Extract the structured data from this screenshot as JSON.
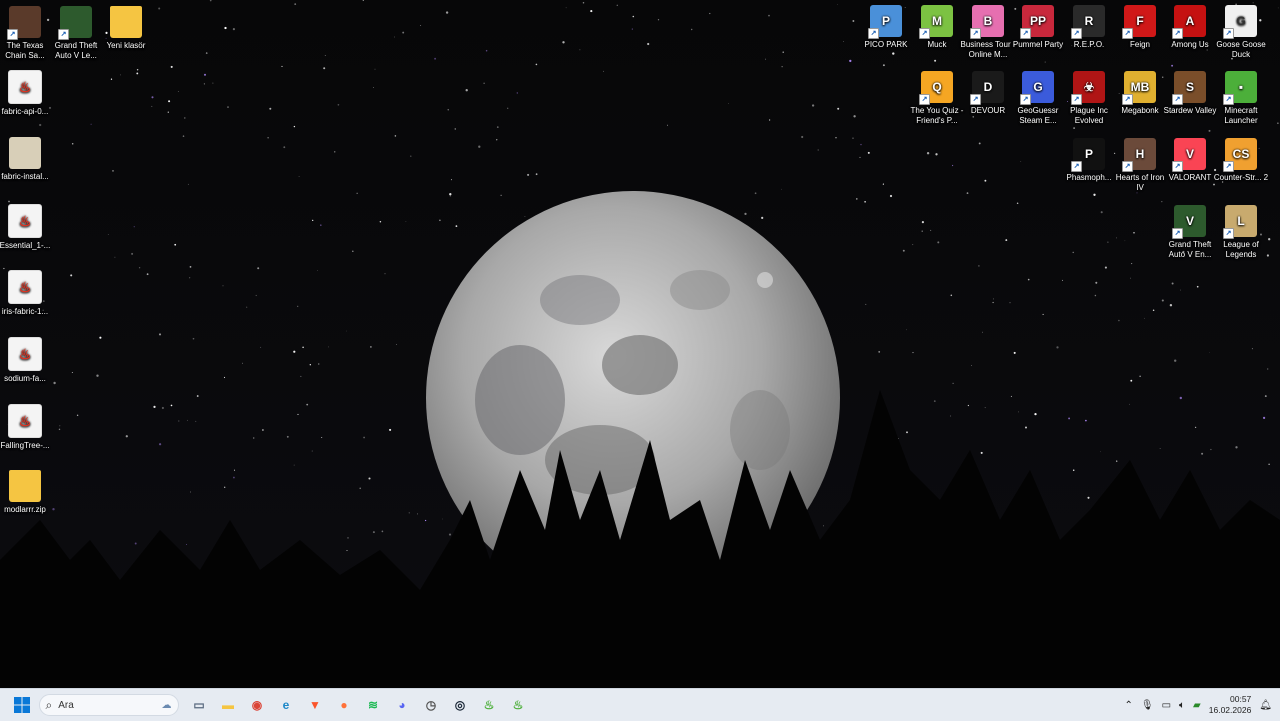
{
  "desktop": {
    "left_icons": [
      {
        "label": "The Texas Chain Sa...",
        "icon": "texas-chainsaw-icon",
        "color": "#5a3a2a"
      },
      {
        "label": "Grand Theft Auto V Le...",
        "icon": "gta-v-icon",
        "color": "#2d5a2d"
      },
      {
        "label": "Yeni klasör",
        "icon": "folder-icon",
        "color": "#f5c542"
      },
      {
        "label": "fabric-api-0...",
        "icon": "java-file-icon",
        "color": "#f4f4f4"
      },
      {
        "label": "fabric-instal...",
        "icon": "installer-icon",
        "color": "#d8cfb8"
      },
      {
        "label": "Essential_1-...",
        "icon": "java-file-icon",
        "color": "#f4f4f4"
      },
      {
        "label": "iris-fabric-1...",
        "icon": "java-file-icon",
        "color": "#f4f4f4"
      },
      {
        "label": "sodium-fa...",
        "icon": "java-file-icon",
        "color": "#f4f4f4"
      },
      {
        "label": "FallingTree-...",
        "icon": "java-file-icon",
        "color": "#f4f4f4"
      },
      {
        "label": "modlarrr.zip",
        "icon": "zip-folder-icon",
        "color": "#f5c542"
      }
    ],
    "right_icons": [
      {
        "label": "PICO PARK",
        "icon": "pico-park-icon",
        "color": "#4a90d9",
        "glyph": "P"
      },
      {
        "label": "Muck",
        "icon": "muck-icon",
        "color": "#7cc242",
        "glyph": "M"
      },
      {
        "label": "Business Tour - Online M...",
        "icon": "business-tour-icon",
        "color": "#e66fb0",
        "glyph": "B"
      },
      {
        "label": "Pummel Party",
        "icon": "pummel-party-icon",
        "color": "#c8283c",
        "glyph": "PP"
      },
      {
        "label": "R.E.P.O.",
        "icon": "repo-icon",
        "color": "#2a2a2a",
        "glyph": "R"
      },
      {
        "label": "Feign",
        "icon": "feign-icon",
        "color": "#d01818",
        "glyph": "F"
      },
      {
        "label": "Among Us",
        "icon": "among-us-icon",
        "color": "#c51111",
        "glyph": "A"
      },
      {
        "label": "Goose Goose Duck",
        "icon": "goose-goose-duck-icon",
        "color": "#f0f0f0",
        "glyph": "G"
      },
      {
        "label": "The You Quiz - Friend's P...",
        "icon": "you-quiz-icon",
        "color": "#f5a623",
        "glyph": "Q"
      },
      {
        "label": "DEVOUR",
        "icon": "devour-icon",
        "color": "#1a1a1a",
        "glyph": "D"
      },
      {
        "label": "GeoGuessr Steam E...",
        "icon": "geoguessr-icon",
        "color": "#3b5bdb",
        "glyph": "G"
      },
      {
        "label": "Plague Inc Evolved",
        "icon": "plague-inc-icon",
        "color": "#b01515",
        "glyph": "☣"
      },
      {
        "label": "Megabonk",
        "icon": "megabonk-icon",
        "color": "#e0b030",
        "glyph": "MB"
      },
      {
        "label": "Stardew Valley",
        "icon": "stardew-valley-icon",
        "color": "#7a4e2a",
        "glyph": "S"
      },
      {
        "label": "Minecraft Launcher",
        "icon": "minecraft-icon",
        "color": "#4caf3a",
        "glyph": "▪"
      },
      {
        "label": "Phasmoph...",
        "icon": "phasmophobia-icon",
        "color": "#111111",
        "glyph": "P"
      },
      {
        "label": "Hearts of Iron IV",
        "icon": "hearts-of-iron-icon",
        "color": "#6b4a3a",
        "glyph": "H"
      },
      {
        "label": "VALORANT",
        "icon": "valorant-icon",
        "color": "#fa4454",
        "glyph": "V"
      },
      {
        "label": "Counter-Str... 2",
        "icon": "counter-strike-icon",
        "color": "#f0a030",
        "glyph": "CS"
      },
      {
        "label": "Grand Theft Auto V En...",
        "icon": "gta-v-icon",
        "color": "#2d5a2d",
        "glyph": "V"
      },
      {
        "label": "League of Legends",
        "icon": "league-of-legends-icon",
        "color": "#c8aa6e",
        "glyph": "L"
      }
    ]
  },
  "taskbar": {
    "search_placeholder": "Ara",
    "apps": [
      {
        "icon": "task-view-icon",
        "color": "#5a6a80",
        "glyph": "▭"
      },
      {
        "icon": "file-explorer-icon",
        "color": "#f5c542",
        "glyph": "▬"
      },
      {
        "icon": "chrome-icon",
        "color": "#db4437",
        "glyph": "◉"
      },
      {
        "icon": "edge-icon",
        "color": "#1e88c8",
        "glyph": "e"
      },
      {
        "icon": "brave-icon",
        "color": "#fb542b",
        "glyph": "▼"
      },
      {
        "icon": "firefox-icon",
        "color": "#ff7139",
        "glyph": "●"
      },
      {
        "icon": "spotify-icon",
        "color": "#1db954",
        "glyph": "≋"
      },
      {
        "icon": "discord-icon",
        "color": "#5865f2",
        "glyph": "◕"
      },
      {
        "icon": "clock-app-icon",
        "color": "#555555",
        "glyph": "◷"
      },
      {
        "icon": "steam-icon",
        "color": "#1b2838",
        "glyph": "◎"
      },
      {
        "icon": "java-tray-icon",
        "color": "#4caf3a",
        "glyph": "♨"
      },
      {
        "icon": "minecraft-launcher-taskbar-icon",
        "color": "#4caf3a",
        "glyph": "♨"
      }
    ],
    "tray": {
      "time": "00:57",
      "date": "16.02.2026"
    }
  }
}
